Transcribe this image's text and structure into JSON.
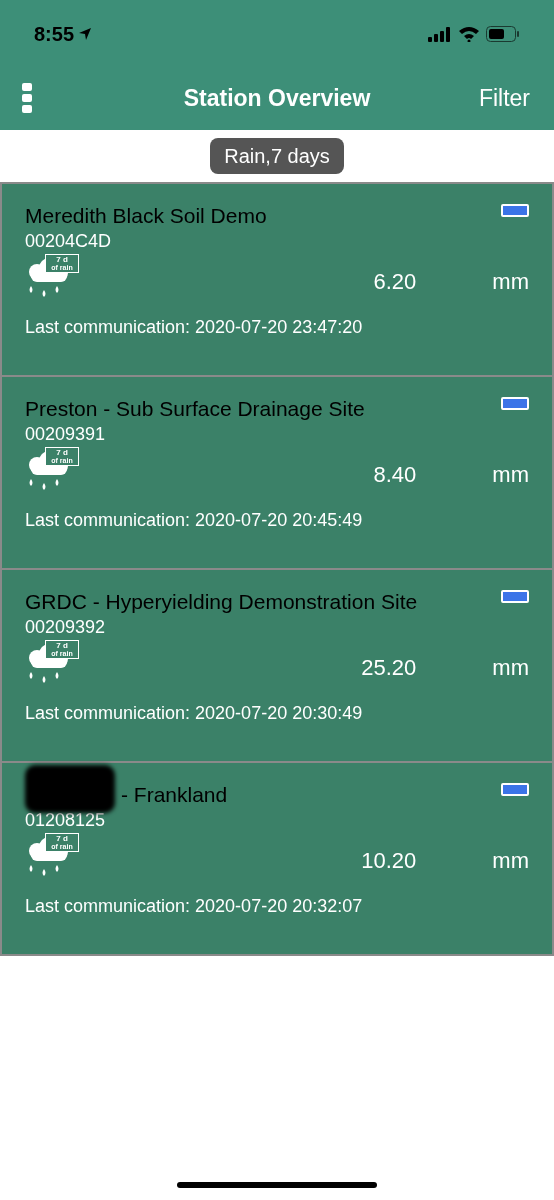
{
  "status_bar": {
    "time": "8:55"
  },
  "header": {
    "title": "Station Overview",
    "filter": "Filter"
  },
  "chip": {
    "label": "Rain,7 days"
  },
  "stations": [
    {
      "name": "Meredith Black Soil Demo",
      "redacted": false,
      "id": "00204C4D",
      "icon_badge": [
        "7 d",
        "of rain"
      ],
      "value": "6.20",
      "unit": "mm",
      "last": "Last communication: 2020-07-20 23:47:20",
      "battery": {
        "level": 1
      }
    },
    {
      "name": "Preston - Sub Surface Drainage Site",
      "redacted": false,
      "id": "00209391",
      "icon_badge": [
        "7 d",
        "of rain"
      ],
      "value": "8.40",
      "unit": "mm",
      "last": "Last communication: 2020-07-20 20:45:49",
      "battery": {
        "level": 1
      }
    },
    {
      "name": "GRDC - Hyperyielding Demonstration Site",
      "redacted": false,
      "id": "00209392",
      "icon_badge": [
        "7 d",
        "of rain"
      ],
      "value": "25.20",
      "unit": "mm",
      "last": "Last communication: 2020-07-20 20:30:49",
      "battery": {
        "level": 1
      }
    },
    {
      "name": "- Frankland",
      "redacted": true,
      "id": "01208125",
      "icon_badge": [
        "7 d",
        "of rain"
      ],
      "value": "10.20",
      "unit": "mm",
      "last": "Last communication: 2020-07-20 20:32:07",
      "battery": {
        "level": 1
      }
    }
  ]
}
